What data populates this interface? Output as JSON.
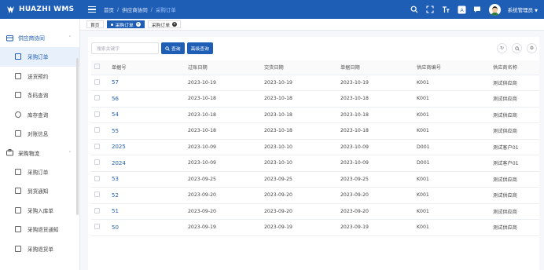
{
  "header": {
    "logo_text": "HUAZHI WMS",
    "breadcrumb": [
      "首页",
      "供应商协同",
      "采购订单"
    ],
    "user_name": "系统管理员"
  },
  "sidebar": {
    "groups": [
      {
        "label": "供应商协同",
        "items": [
          "采购订单",
          "送货预约",
          "条码查询",
          "库存查询",
          "对账信息"
        ]
      },
      {
        "label": "采购物流",
        "items": [
          "采购订单",
          "到货通知",
          "采购入库单",
          "采购退货通知",
          "采购退货单"
        ]
      }
    ]
  },
  "tags": [
    "首页",
    "采购订单",
    "采购订单"
  ],
  "search": {
    "placeholder": "搜索关键字",
    "search_btn": "查询",
    "advanced_btn": "高级查询"
  },
  "table": {
    "columns": [
      "单据号",
      "过账日期",
      "交货日期",
      "单据日期",
      "供应商编号",
      "供应商名称"
    ],
    "rows": [
      [
        "57",
        "2023-10-19",
        "2023-10-19",
        "2023-10-19",
        "K001",
        "测试供应商"
      ],
      [
        "56",
        "2023-10-18",
        "2023-10-18",
        "2023-10-18",
        "K001",
        "测试供应商"
      ],
      [
        "54",
        "2023-10-18",
        "2023-10-18",
        "2023-10-18",
        "K001",
        "测试供应商"
      ],
      [
        "55",
        "2023-10-18",
        "2023-10-18",
        "2023-10-18",
        "K001",
        "测试供应商"
      ],
      [
        "2025",
        "2023-10-09",
        "2023-10-10",
        "2023-10-09",
        "D001",
        "测试客户01"
      ],
      [
        "2024",
        "2023-10-09",
        "2023-10-10",
        "2023-10-09",
        "D001",
        "测试客户01"
      ],
      [
        "53",
        "2023-09-25",
        "2023-09-25",
        "2023-09-25",
        "K001",
        "测试供应商"
      ],
      [
        "52",
        "2023-09-20",
        "2023-09-20",
        "2023-09-20",
        "K001",
        "测试供应商"
      ],
      [
        "51",
        "2023-09-20",
        "2023-09-20",
        "2023-09-20",
        "K001",
        "测试供应商"
      ],
      [
        "50",
        "2023-09-19",
        "2023-09-19",
        "2023-09-19",
        "K001",
        "测试供应商"
      ]
    ]
  },
  "colors": {
    "primary": "#1f5eb5",
    "link": "#1f5eb5"
  }
}
